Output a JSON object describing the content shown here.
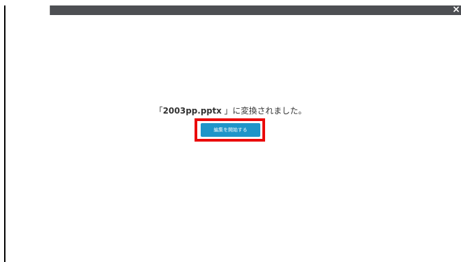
{
  "titlebar": {
    "close_label": "×"
  },
  "message": {
    "open_bracket": "「",
    "filename": "2003pp.pptx",
    "close_bracket": " 」",
    "suffix": "に変換されました。"
  },
  "actions": {
    "start_edit_label": "編集を開始する"
  },
  "colors": {
    "titlebar_bg": "#4d4f53",
    "button_bg": "#1f95c9",
    "highlight_border": "#ea0a0a"
  },
  "icons": {
    "close": "close-icon"
  }
}
